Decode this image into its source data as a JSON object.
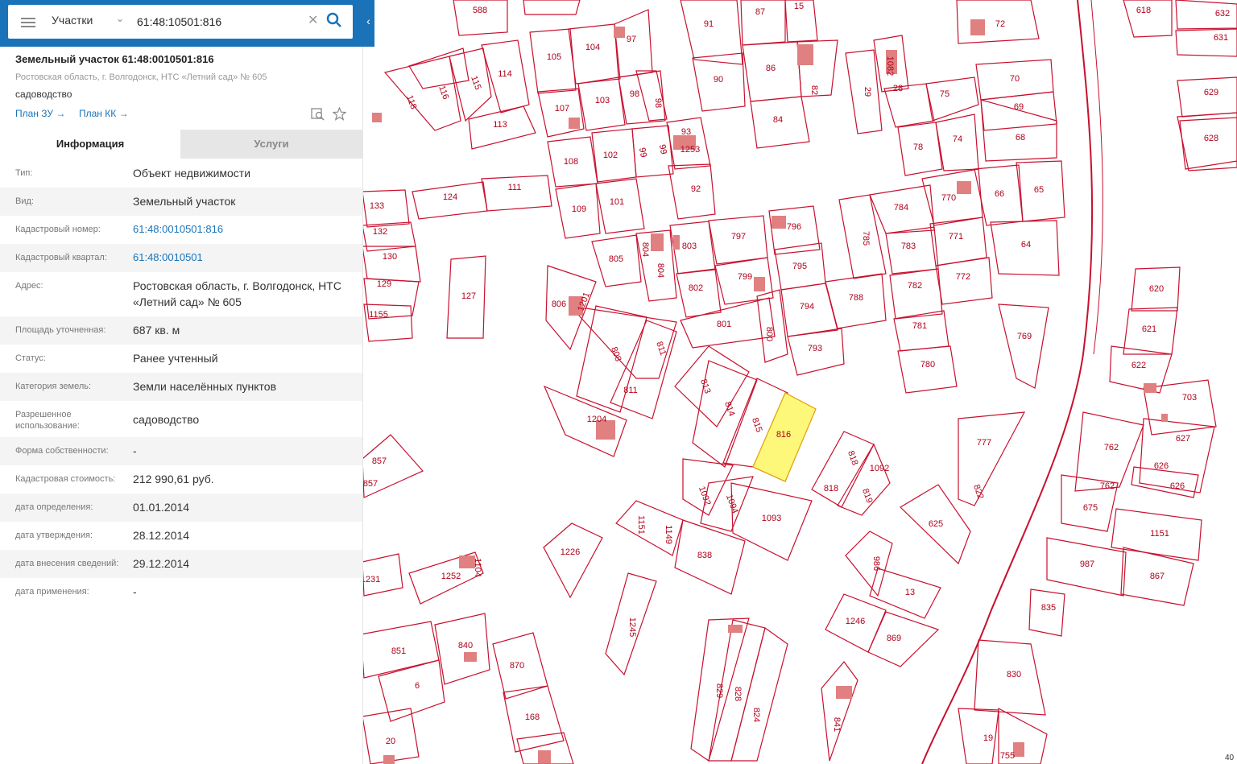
{
  "search": {
    "layer": "Участки",
    "query": "61:48:10501:816"
  },
  "card": {
    "title": "Земельный участок 61:48:0010501:816",
    "address_short": "Ростовская область, г. Волгодонск, НТС «Летний сад» № 605",
    "use": "садоводство",
    "link_plan_zu": "План ЗУ →",
    "link_plan_kk": "План КК →"
  },
  "tabs": {
    "info": "Информация",
    "services": "Услуги"
  },
  "rows": [
    {
      "label": "Тип:",
      "value": "Объект недвижимости"
    },
    {
      "label": "Вид:",
      "value": "Земельный участок"
    },
    {
      "label": "Кадастровый номер:",
      "value": "61:48:0010501:816"
    },
    {
      "label": "Кадастровый квартал:",
      "value": "61:48:0010501"
    },
    {
      "label": "Адрес:",
      "value": "Ростовская область, г. Волгодонск, НТС «Летний сад» № 605"
    },
    {
      "label": "Площадь уточненная:",
      "value": "687 кв. м"
    },
    {
      "label": "Статус:",
      "value": "Ранее учтенный"
    },
    {
      "label": "Категория земель:",
      "value": "Земли населённых пунктов"
    },
    {
      "label": "Разрешенное использование:",
      "value": "садоводство"
    },
    {
      "label": "Форма собственности:",
      "value": "-"
    },
    {
      "label": "Кадастровая стоимость:",
      "value": "212 990,61 руб."
    },
    {
      "label": "дата определения:",
      "value": "01.01.2014"
    },
    {
      "label": "дата утверждения:",
      "value": "28.12.2014"
    },
    {
      "label": "дата внесения сведений:",
      "value": "29.12.2014"
    },
    {
      "label": "дата применения:",
      "value": "-"
    }
  ],
  "map": {
    "selected_parcel": "816",
    "scale_text": "40",
    "parcel_labels": [
      "588",
      "91",
      "87",
      "15",
      "72",
      "618",
      "632",
      "631",
      "105",
      "104",
      "97",
      "90",
      "86",
      "82",
      "1082",
      "29",
      "28",
      "75",
      "70",
      "69",
      "629",
      "118",
      "116",
      "115",
      "114",
      "113",
      "107",
      "103",
      "98",
      "98",
      "84",
      "68",
      "628",
      "93",
      "1253",
      "99",
      "99",
      "108",
      "102",
      "92",
      "78",
      "74",
      "66",
      "65",
      "124",
      "111",
      "109",
      "101",
      "784",
      "770",
      "785",
      "133",
      "132",
      "130",
      "129",
      "1155",
      "127",
      "805",
      "804",
      "803",
      "797",
      "796",
      "795",
      "783",
      "771",
      "64",
      "804",
      "802",
      "799",
      "794",
      "788",
      "782",
      "772",
      "620",
      "806",
      "1201",
      "801",
      "800",
      "793",
      "781",
      "769",
      "621",
      "808",
      "811",
      "813",
      "780",
      "622",
      "811",
      "814",
      "815",
      "816",
      "703",
      "1204",
      "818",
      "777",
      "627",
      "857",
      "857",
      "1092",
      "1092",
      "1094",
      "1093",
      "818",
      "819",
      "762",
      "626",
      "762",
      "626",
      "675",
      "822",
      "625",
      "1151",
      "1151",
      "1149",
      "838",
      "1226",
      "986",
      "987",
      "867",
      "1231",
      "1252",
      "1104",
      "13",
      "835",
      "1245",
      "1246",
      "869",
      "851",
      "840",
      "870",
      "6",
      "830",
      "829",
      "828",
      "824",
      "841",
      "168",
      "20",
      "19",
      "755"
    ]
  }
}
